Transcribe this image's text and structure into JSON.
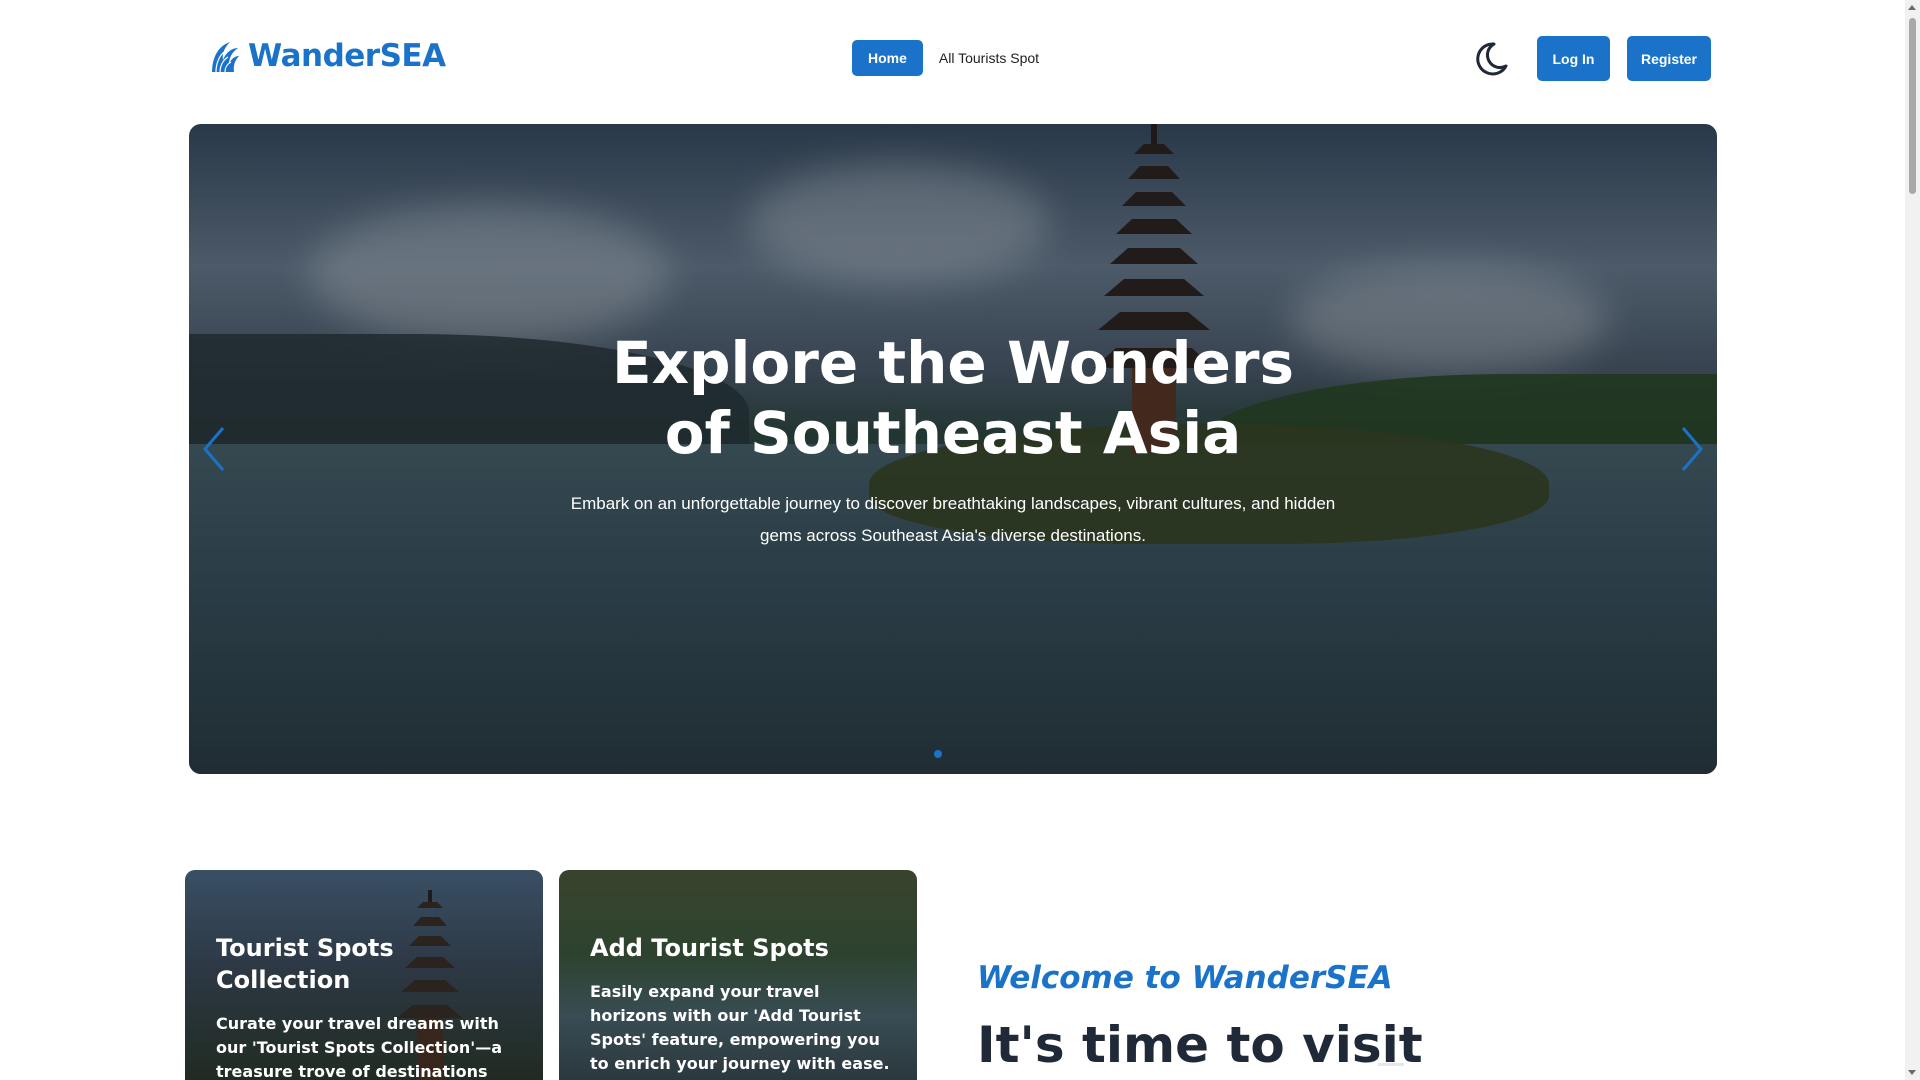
{
  "brand": {
    "name": "WanderSEA",
    "icon": "wave-logo-icon",
    "color": "#1a73c8"
  },
  "nav": {
    "items": [
      {
        "label": "Home",
        "active": true
      },
      {
        "label": "All Tourists Spot",
        "active": false
      }
    ]
  },
  "header": {
    "theme_toggle_icon": "moon-icon",
    "login_label": "Log In",
    "register_label": "Register"
  },
  "hero": {
    "title_line1": "Explore the Wonders",
    "title_line2": "of Southeast Asia",
    "subtitle": "Embark on an unforgettable journey to discover breathtaking landscapes, vibrant cultures, and hidden gems across Southeast Asia's diverse destinations.",
    "prev_icon": "chevron-left-icon",
    "next_icon": "chevron-right-icon",
    "active_slide": 1
  },
  "cards": [
    {
      "title": "Tourist Spots Collection",
      "text": "Curate your travel dreams with our 'Tourist Spots Collection'—a treasure trove of destinations"
    },
    {
      "title": "Add Tourist Spots",
      "text": "Easily expand your travel horizons with our 'Add Tourist Spots' feature, empowering you to enrich your journey with ease."
    }
  ],
  "welcome": {
    "tagline": "Welcome to WanderSEA",
    "heading": "It's time to visit"
  }
}
